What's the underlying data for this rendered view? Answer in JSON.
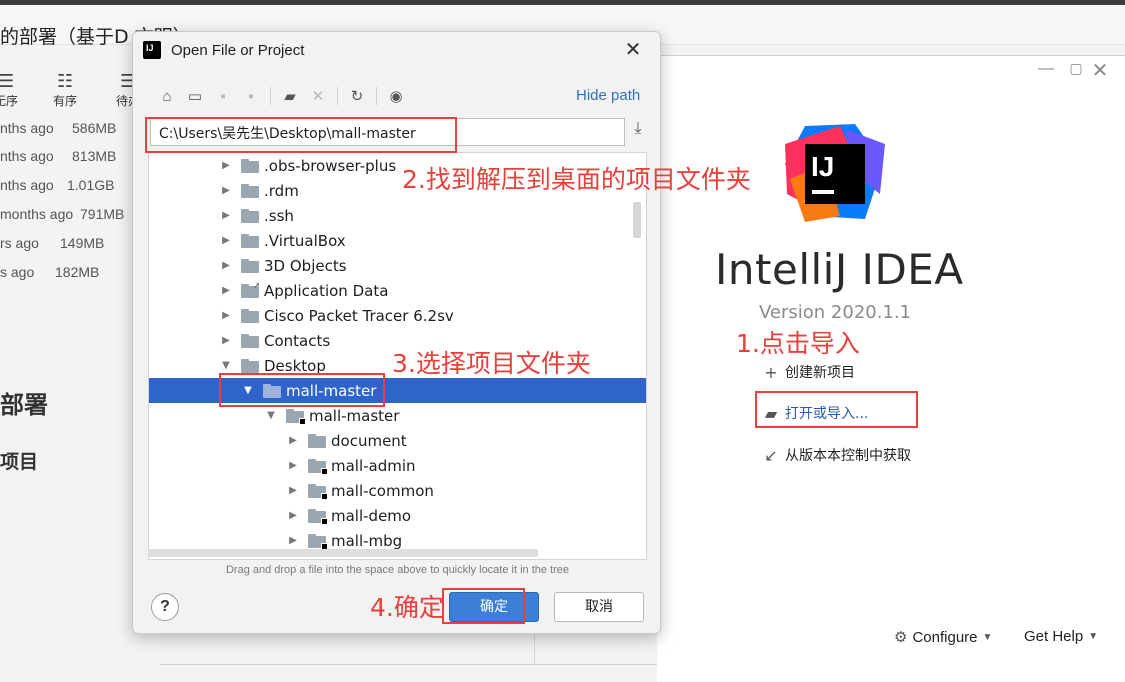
{
  "background": {
    "title": "的部署（基于D",
    "title_suffix": "  文明）",
    "toolbar": [
      {
        "icon": "list-icon",
        "label": "无序"
      },
      {
        "icon": "ordered-list-icon",
        "label": "有序"
      },
      {
        "icon": "todo-icon",
        "label": "待办"
      }
    ],
    "recent": [
      {
        "ago": "nths ago",
        "size": "586MB"
      },
      {
        "ago": "nths ago",
        "size": "813MB"
      },
      {
        "ago": "nths ago",
        "size": "1.01GB"
      },
      {
        "ago": "months ago",
        "size": "791MB"
      },
      {
        "ago": "rs ago",
        "size": "149MB"
      },
      {
        "ago": "s ago",
        "size": "182MB"
      }
    ],
    "heading1": "部署",
    "heading2": "项目"
  },
  "welcome": {
    "product_name": "IntelliJ IDEA",
    "version": "Version 2020.1.1",
    "actions": {
      "create": "创建新项目",
      "open": "打开或导入...",
      "vcs": "从版本本控制中获取"
    },
    "configure": "Configure",
    "get_help": "Get Help",
    "window_controls": {
      "minimize": "—",
      "maximize": "▢",
      "close": "✕"
    }
  },
  "dialog": {
    "title": "Open File or Project",
    "hide_path": "Hide path",
    "path_value": "C:\\Users\\吴先生\\Desktop\\mall-master",
    "tree": [
      {
        "label": ".obs-browser-plus",
        "expanded": false
      },
      {
        "label": ".rdm",
        "expanded": false
      },
      {
        "label": ".ssh",
        "expanded": false
      },
      {
        "label": ".VirtualBox",
        "expanded": false
      },
      {
        "label": "3D Objects",
        "expanded": false
      },
      {
        "label": "Application Data",
        "expanded": false
      },
      {
        "label": "Cisco Packet Tracer 6.2sv",
        "expanded": false
      },
      {
        "label": "Contacts",
        "expanded": false
      },
      {
        "label": "Desktop",
        "expanded": true
      },
      {
        "label": "mall-master",
        "expanded": true,
        "selected": true
      },
      {
        "label": "mall-master",
        "expanded": true
      },
      {
        "label": "document",
        "expanded": false
      },
      {
        "label": "mall-admin",
        "expanded": false
      },
      {
        "label": "mall-common",
        "expanded": false
      },
      {
        "label": "mall-demo",
        "expanded": false
      },
      {
        "label": "mall-mbg",
        "expanded": false
      }
    ],
    "hint": "Drag and drop a file into the space above to quickly locate it in the tree",
    "help_label": "?",
    "ok_label": "确定",
    "cancel_label": "取消"
  },
  "annotations": {
    "step1": "1.点击导入",
    "step2": "2.找到解压到桌面的项目文件夹",
    "step3": "3.选择项目文件夹",
    "step4": "4.确定"
  },
  "colors": {
    "annotation": "#e8403a",
    "selection": "#2f65ca",
    "ok_button": "#3b7fd6",
    "link": "#2f6fbf"
  }
}
